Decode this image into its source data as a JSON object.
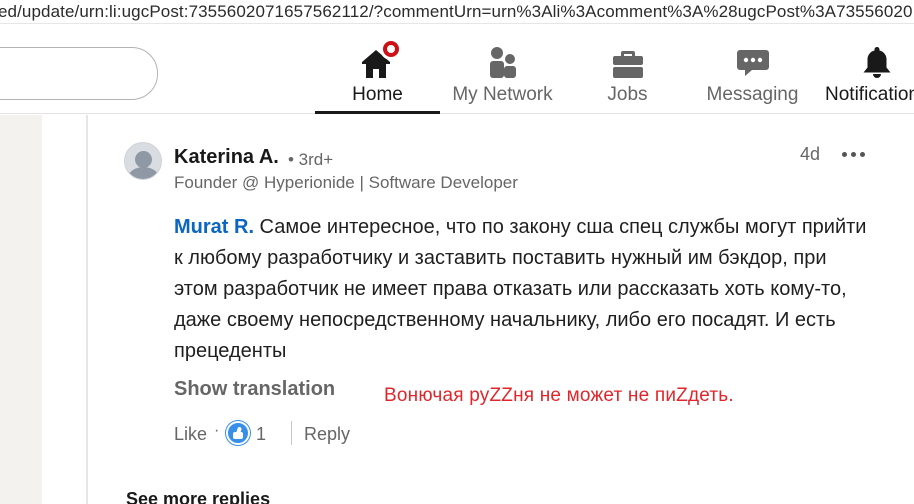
{
  "browser": {
    "url": "ed/update/urn:li:ugcPost:7355602071657562112/?commentUrn=urn%3Ali%3Acomment%3A%28ugcPost%3A73556020"
  },
  "nav": {
    "home": {
      "label": "Home",
      "icon": "home-icon",
      "active": true
    },
    "network": {
      "label": "My Network",
      "icon": "people-icon"
    },
    "jobs": {
      "label": "Jobs",
      "icon": "briefcase-icon"
    },
    "messaging": {
      "label": "Messaging",
      "icon": "chat-bubble-icon"
    },
    "notifications": {
      "label": "Notifications",
      "icon": "bell-icon"
    }
  },
  "comment": {
    "author": "Katerina A.",
    "degree": "• 3rd+",
    "headline": "Founder @ Hyperionide | Software Developer",
    "time": "4d",
    "mention": "Murat R.",
    "text": " Самое интересное, что по закону сша спец службы могут прийти к любому разработчику и заставить поставить нужный им бэкдор, при этом разработчик не имеет права отказать или рассказать хоть кому-то, даже своему непосредственному начальнику, либо его посадят. И есть прецеденты",
    "show_translation": "Show translation",
    "like_label": "Like",
    "separator": "·",
    "reaction_count": "1",
    "reply_label": "Reply"
  },
  "overlay_annotation": "Вонючая руZZня не может не пиZдеть.",
  "see_more_replies": "See more replies",
  "colors": {
    "accent_blue": "#0a66c2",
    "notification_red": "#cc1016",
    "annotation_red": "#e0262b",
    "muted_text": "#666666"
  }
}
